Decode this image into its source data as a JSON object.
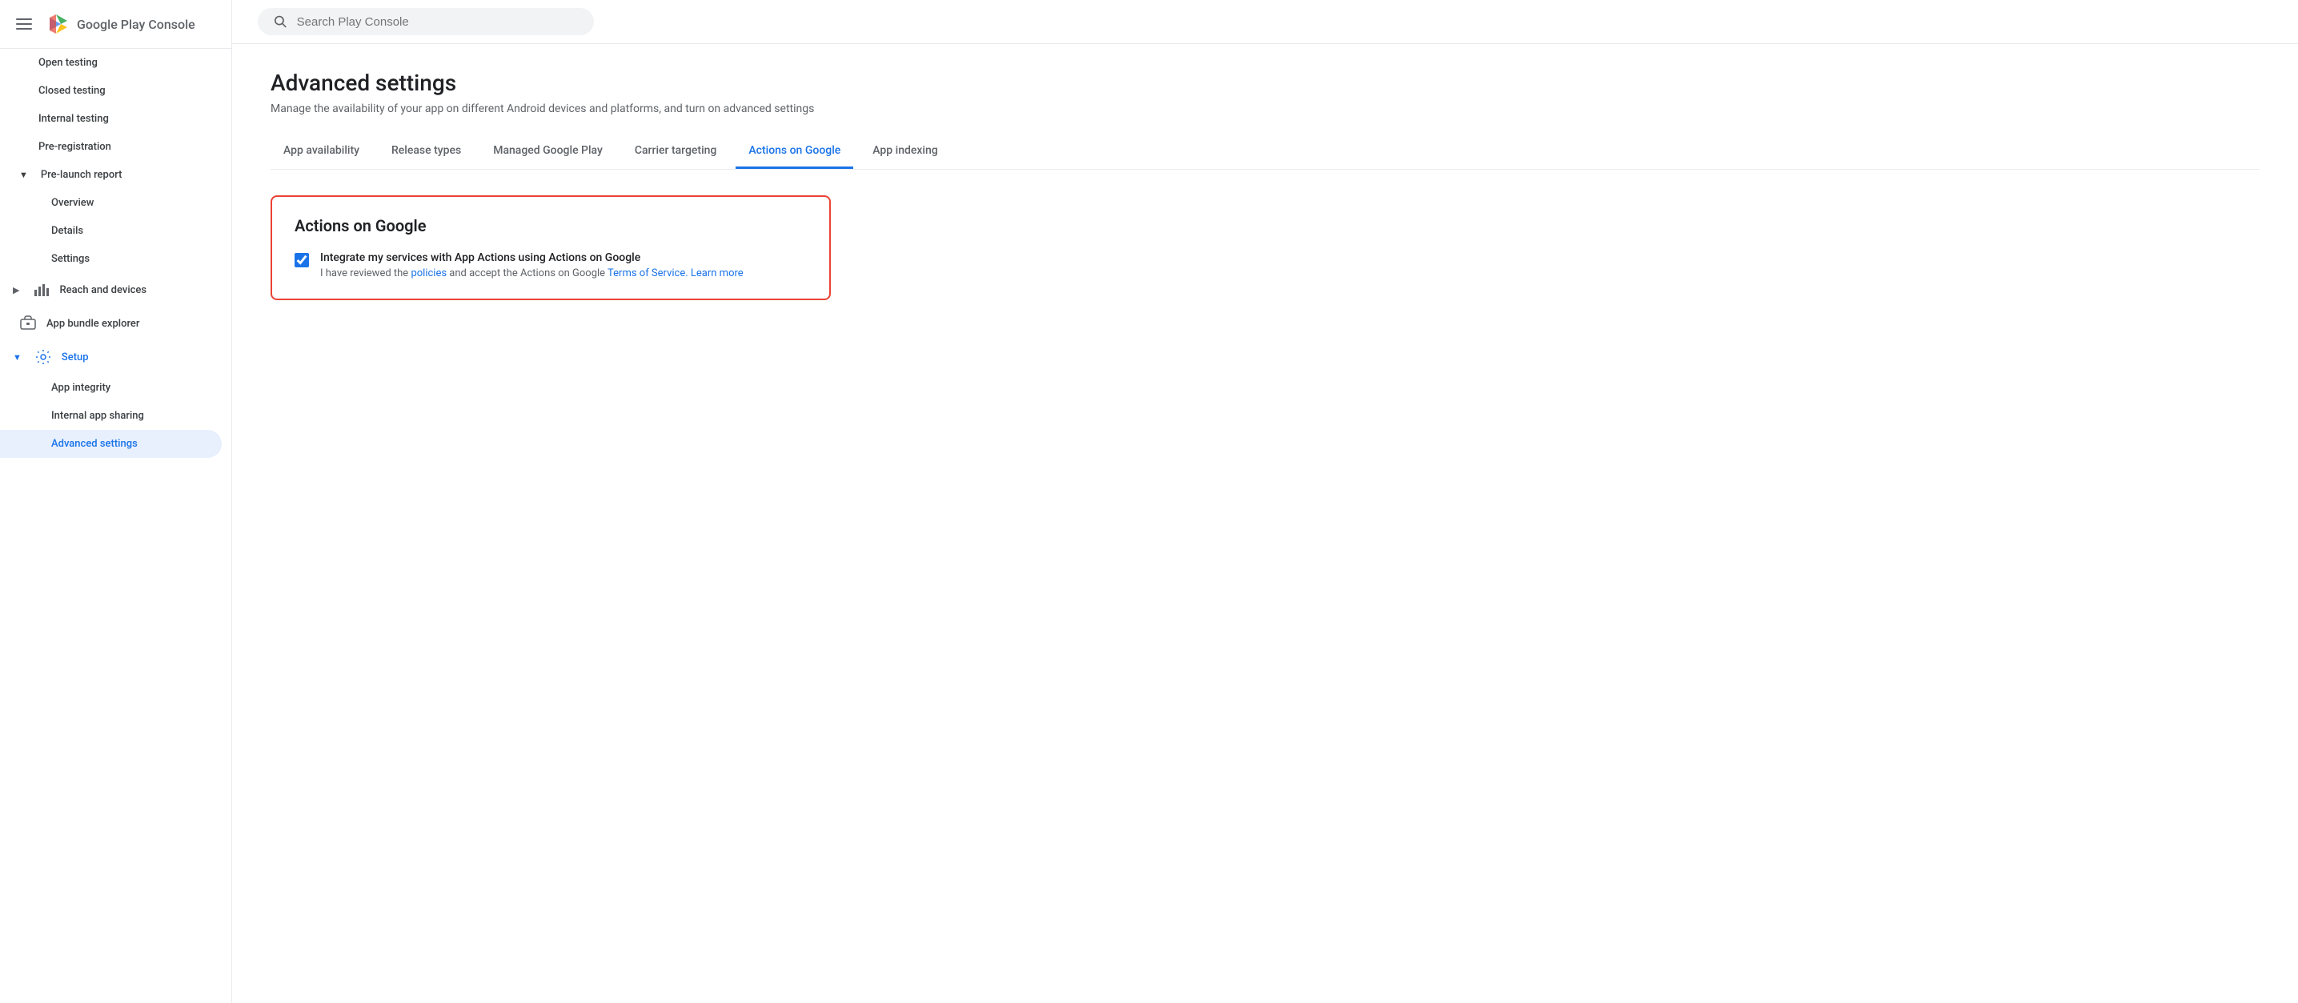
{
  "app": {
    "title": "Google Play Console"
  },
  "search": {
    "placeholder": "Search Play Console"
  },
  "sidebar": {
    "nav_items": [
      {
        "id": "open-testing",
        "label": "Open testing",
        "indented": true,
        "active": false
      },
      {
        "id": "closed-testing",
        "label": "Closed testing",
        "indented": true,
        "active": false
      },
      {
        "id": "internal-testing",
        "label": "Internal testing",
        "indented": true,
        "active": false
      },
      {
        "id": "pre-registration",
        "label": "Pre-registration",
        "indented": true,
        "active": false
      },
      {
        "id": "pre-launch-report",
        "label": "Pre-launch report",
        "indented": false,
        "has_chevron": true,
        "active": false
      },
      {
        "id": "overview",
        "label": "Overview",
        "indented": true,
        "active": false
      },
      {
        "id": "details",
        "label": "Details",
        "indented": true,
        "active": false
      },
      {
        "id": "settings-prelaunch",
        "label": "Settings",
        "indented": true,
        "active": false
      },
      {
        "id": "reach-devices",
        "label": "Reach and devices",
        "indented": false,
        "has_icon": true,
        "active": false
      },
      {
        "id": "app-bundle",
        "label": "App bundle explorer",
        "indented": false,
        "has_icon": true,
        "active": false
      },
      {
        "id": "setup",
        "label": "Setup",
        "indented": false,
        "has_icon": true,
        "active": false,
        "is_setup": true
      },
      {
        "id": "app-integrity",
        "label": "App integrity",
        "indented": true,
        "active": false
      },
      {
        "id": "internal-app-sharing",
        "label": "Internal app sharing",
        "indented": true,
        "active": false
      },
      {
        "id": "advanced-settings",
        "label": "Advanced settings",
        "indented": true,
        "active": true
      }
    ]
  },
  "page": {
    "title": "Advanced settings",
    "subtitle": "Manage the availability of your app on different Android devices and platforms, and turn on advanced settings"
  },
  "tabs": [
    {
      "id": "app-availability",
      "label": "App availability",
      "active": false
    },
    {
      "id": "release-types",
      "label": "Release types",
      "active": false
    },
    {
      "id": "managed-google-play",
      "label": "Managed Google Play",
      "active": false
    },
    {
      "id": "carrier-targeting",
      "label": "Carrier targeting",
      "active": false
    },
    {
      "id": "actions-on-google",
      "label": "Actions on Google",
      "active": true
    },
    {
      "id": "app-indexing",
      "label": "App indexing",
      "active": false
    }
  ],
  "content": {
    "card_title": "Actions on Google",
    "checkbox_main_label": "Integrate my services with App Actions using Actions on Google",
    "checkbox_sub_label_before": "I have reviewed the ",
    "policies_link": "policies",
    "checkbox_sub_label_mid": " and accept the Actions on Google ",
    "tos_link": "Terms of Service.",
    "learn_more_link": "Learn more"
  }
}
